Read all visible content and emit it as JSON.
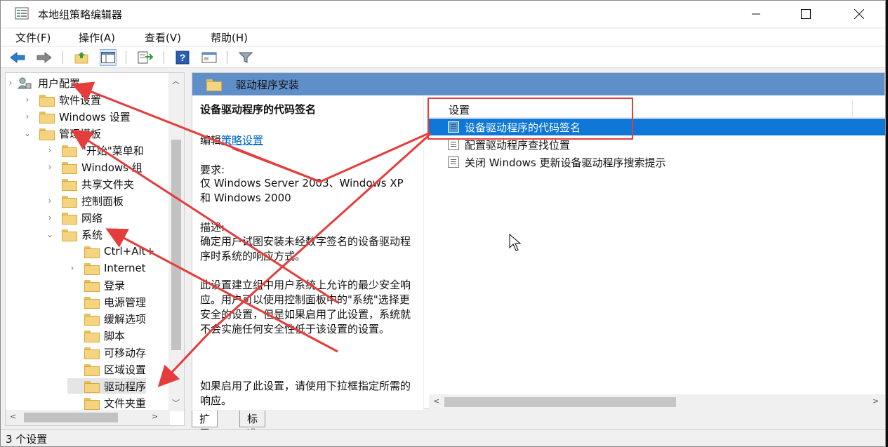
{
  "window": {
    "title": "本地组策略编辑器"
  },
  "menu": [
    "文件(F)",
    "操作(A)",
    "查看(V)",
    "帮助(H)"
  ],
  "toolbar_icons": [
    "back-icon",
    "forward-icon",
    "up-folder-icon",
    "show-hide-tree-icon",
    "export-list-icon",
    "help-icon",
    "properties-view-icon",
    "filter-icon"
  ],
  "tree": {
    "root": "用户配置",
    "items": [
      {
        "label": "软件设置",
        "level": 1,
        "expander": ">"
      },
      {
        "label": "Windows 设置",
        "level": 1,
        "expander": ">"
      },
      {
        "label": "管理模板",
        "level": 1,
        "expander": "v"
      },
      {
        "label": "\"开始\"菜单和",
        "level": 2,
        "expander": ">"
      },
      {
        "label": "Windows 组",
        "level": 2,
        "expander": ">"
      },
      {
        "label": "共享文件夹",
        "level": 2,
        "expander": ""
      },
      {
        "label": "控制面板",
        "level": 2,
        "expander": ">"
      },
      {
        "label": "网络",
        "level": 2,
        "expander": ">"
      },
      {
        "label": "系统",
        "level": 2,
        "expander": "v"
      },
      {
        "label": "Ctrl+Alt+",
        "level": 3,
        "expander": ""
      },
      {
        "label": "Internet",
        "level": 3,
        "expander": ">"
      },
      {
        "label": "登录",
        "level": 3,
        "expander": ""
      },
      {
        "label": "电源管理",
        "level": 3,
        "expander": ""
      },
      {
        "label": "缓解选项",
        "level": 3,
        "expander": ""
      },
      {
        "label": "脚本",
        "level": 3,
        "expander": ""
      },
      {
        "label": "可移动存",
        "level": 3,
        "expander": ""
      },
      {
        "label": "区域设置",
        "level": 3,
        "expander": ""
      },
      {
        "label": "驱动程序",
        "level": 3,
        "expander": "",
        "selected": true
      },
      {
        "label": "文件夹重",
        "level": 3,
        "expander": ""
      }
    ]
  },
  "header": {
    "title": "驱动程序安装"
  },
  "description": {
    "title": "设备驱动程序的代码签名",
    "edit_prefix": "编辑",
    "edit_link": "策略设置",
    "requirements_label": "要求:",
    "requirements_text": "仅 Windows Server 2003、Windows XP 和 Windows 2000",
    "description_label": "描述:",
    "desc_1": "确定用户试图安装未经数字签名的设备驱动程序时系统的响应方式。",
    "desc_2": "此设置建立组中用户系统上允许的最少安全响应。用户可以使用控制面板中的\"系统\"选择更安全的设置，但是如果启用了此设置，系统就不会实施任何安全性低于该设置的设置。",
    "desc_3": "如果启用了此设置，请使用下拉框指定所需的响应。"
  },
  "list": {
    "column": "设置",
    "rows": [
      {
        "label": "设备驱动程序的代码签名",
        "selected": true
      },
      {
        "label": "配置驱动程序查找位置",
        "selected": false
      },
      {
        "label": "关闭 Windows 更新设备驱动程序搜索提示",
        "selected": false
      }
    ]
  },
  "tabs": [
    "扩展",
    "标准"
  ],
  "status": "3 个设置",
  "colors": {
    "selection": "#0f78d7",
    "header": "#5f8fc9",
    "annotation": "#e53c3c"
  }
}
